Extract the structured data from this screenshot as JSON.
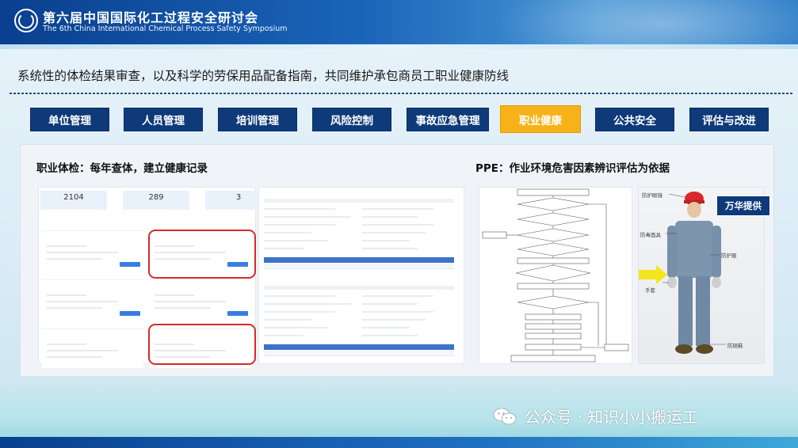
{
  "header": {
    "title": "第六届中国国际化工过程安全研讨会",
    "subtitle": "The 6th China International Chemical Process Safety Symposium"
  },
  "slide": {
    "heading": "系统性的体检结果审查，以及科学的劳保用品配备指南，共同维护承包商员工职业健康防线"
  },
  "tabs": [
    {
      "label": "单位管理",
      "active": false
    },
    {
      "label": "人员管理",
      "active": false
    },
    {
      "label": "培训管理",
      "active": false
    },
    {
      "label": "风险控制",
      "active": false
    },
    {
      "label": "事故应急管理",
      "active": false
    },
    {
      "label": "职业健康",
      "active": true
    },
    {
      "label": "公共安全",
      "active": false
    },
    {
      "label": "评估与改进",
      "active": false
    }
  ],
  "left_section": {
    "title": "职业体检：每年查体，建立健康记录",
    "stats": [
      "2104",
      "289",
      "3"
    ]
  },
  "right_section": {
    "title": "PPE：作业环境危害因素辨识评估为依据",
    "ppe_labels": {
      "helmet": "防护眼镜",
      "mask": "防毒面具",
      "suit": "防护服",
      "gloves": "手套",
      "shoes": "防砸鞋"
    },
    "credit": "万华提供"
  },
  "watermark": "公众号 · 知识小小搬运工",
  "colors": {
    "tab_bg": "#0e3a7a",
    "tab_active": "#f7b219",
    "highlight": "#d22b2b",
    "header_start": "#0a3f8f"
  }
}
